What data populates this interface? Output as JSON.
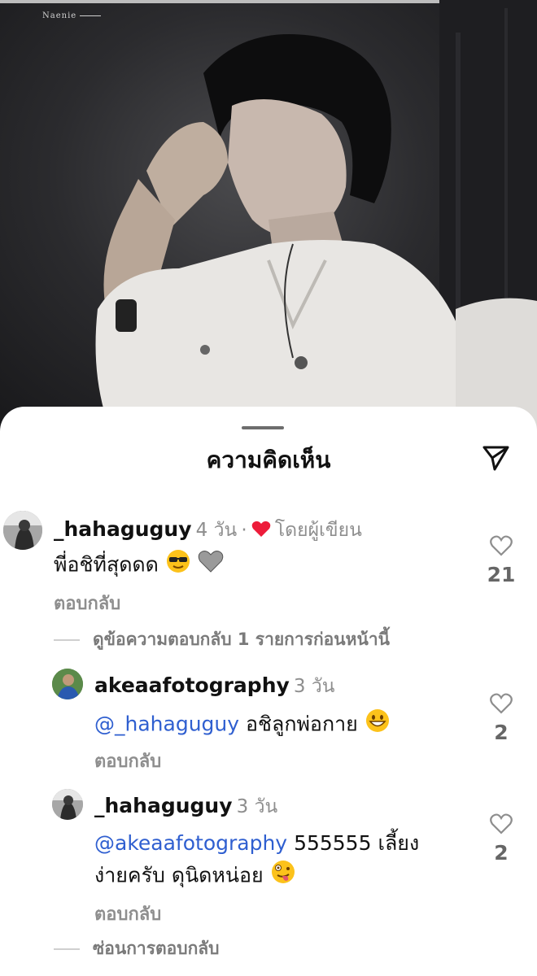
{
  "watermark": "Naenie",
  "sheet": {
    "title": "ความคิดเห็น"
  },
  "comments": [
    {
      "username": "_hahaguguy",
      "time": "4 วัน",
      "separator": "·",
      "author_liked": "โดยผู้เขียน",
      "text": "พี่อชิที่สุดดด",
      "reply_label": "ตอบกลับ",
      "likes": "21",
      "view_prev": "ดูข้อความตอบกลับ 1 รายการก่อนหน้านี้"
    },
    {
      "username": "akeaafotography",
      "time": "3 วัน",
      "mention": "@_hahaguguy",
      "text": "อชิลูกพ่อกาย",
      "reply_label": "ตอบกลับ",
      "likes": "2"
    },
    {
      "username": "_hahaguguy",
      "time": "3 วัน",
      "mention": "@akeaafotography",
      "text": "555555 เลี้ยง",
      "text2": "ง่ายครับ ดุนิดหน่อย",
      "reply_label": "ตอบกลับ",
      "likes": "2",
      "hide_replies": "ซ่อนการตอบกลับ"
    }
  ],
  "colors": {
    "mention": "#2f5fd0",
    "heart": "#ed1c3a",
    "muted": "#8e8e8e"
  }
}
